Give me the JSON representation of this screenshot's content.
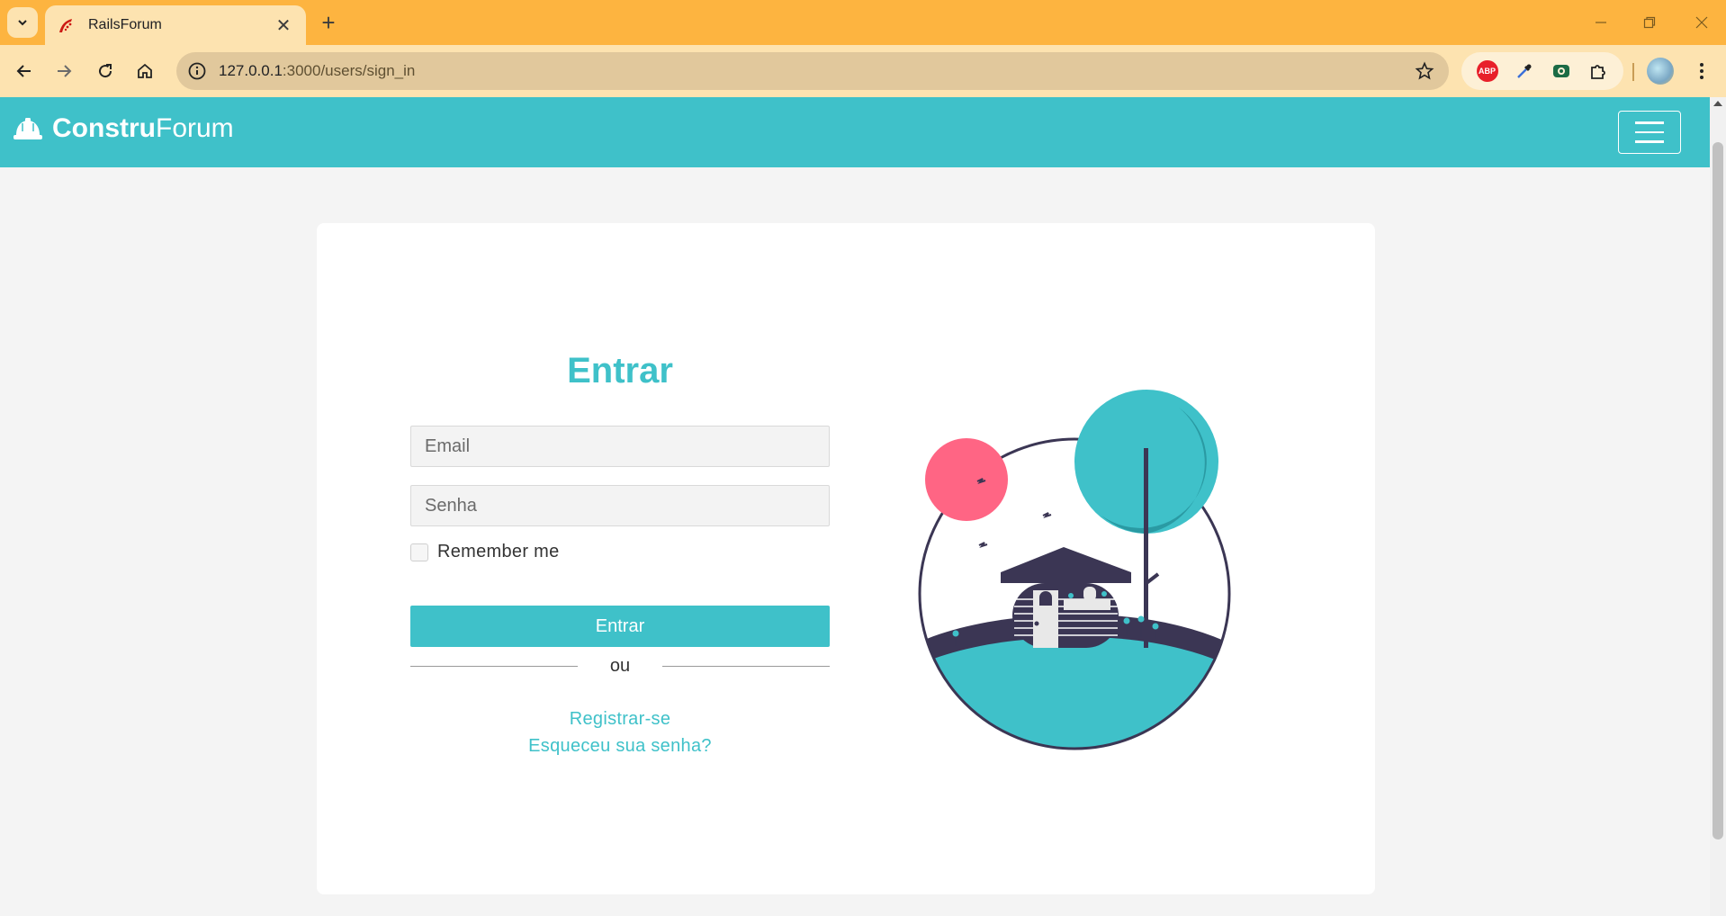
{
  "browser": {
    "tab_title": "RailsForum",
    "url_host": "127.0.0.1",
    "url_path": ":3000/users/sign_in",
    "extensions": [
      "adblock-plus-icon",
      "eyedropper-icon",
      "screen-capture-icon",
      "puzzle-icon"
    ],
    "abp_label": "ABP"
  },
  "site": {
    "brand_bold": "Constru",
    "brand_regular": "Forum",
    "accent_color": "#3fc1c9"
  },
  "login": {
    "title": "Entrar",
    "email_placeholder": "Email",
    "password_placeholder": "Senha",
    "remember_label": "Remember me",
    "submit_label": "Entrar",
    "divider_text": "ou",
    "register_link": "Registrar-se",
    "forgot_link": "Esqueceu sua senha?"
  }
}
